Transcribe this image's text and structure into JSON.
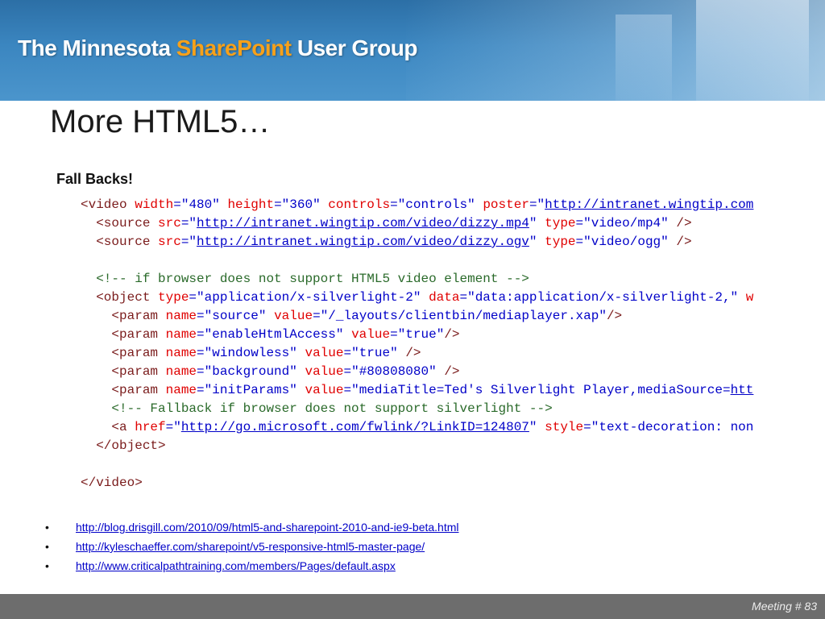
{
  "banner": {
    "title_prefix": "The Minnesota ",
    "title_brand": "SharePoint",
    "title_suffix": " User Group",
    "brand_color": "#f7a11a"
  },
  "slide": {
    "title": "More HTML5…",
    "subhead": "Fall Backs!"
  },
  "code_lines": [
    [
      [
        "t",
        "<video "
      ],
      [
        "a",
        "width"
      ],
      [
        "p",
        "="
      ],
      [
        "v",
        "\"480\" "
      ],
      [
        "a",
        "height"
      ],
      [
        "p",
        "="
      ],
      [
        "v",
        "\"360\" "
      ],
      [
        "a",
        "controls"
      ],
      [
        "p",
        "="
      ],
      [
        "v",
        "\"controls\" "
      ],
      [
        "a",
        "poster"
      ],
      [
        "p",
        "=\""
      ],
      [
        "u",
        "http://intranet.wingtip.com"
      ]
    ],
    [
      [
        "t",
        "  <source "
      ],
      [
        "a",
        "src"
      ],
      [
        "p",
        "=\""
      ],
      [
        "u",
        "http://intranet.wingtip.com/video/dizzy.mp4"
      ],
      [
        "p",
        "\" "
      ],
      [
        "a",
        "type"
      ],
      [
        "p",
        "="
      ],
      [
        "v",
        "\"video/mp4\" "
      ],
      [
        "t",
        "/>"
      ]
    ],
    [
      [
        "t",
        "  <source "
      ],
      [
        "a",
        "src"
      ],
      [
        "p",
        "=\""
      ],
      [
        "u",
        "http://intranet.wingtip.com/video/dizzy.ogv"
      ],
      [
        "p",
        "\" "
      ],
      [
        "a",
        "type"
      ],
      [
        "p",
        "="
      ],
      [
        "v",
        "\"video/ogg\" "
      ],
      [
        "t",
        "/>"
      ]
    ],
    [],
    [
      [
        "c",
        "  <!-- if browser does not support HTML5 video element -->"
      ]
    ],
    [
      [
        "t",
        "  <object "
      ],
      [
        "a",
        "type"
      ],
      [
        "p",
        "="
      ],
      [
        "v",
        "\"application/x-silverlight-2\" "
      ],
      [
        "a",
        "data"
      ],
      [
        "p",
        "="
      ],
      [
        "v",
        "\"data:application/x-silverlight-2,\" "
      ],
      [
        "a",
        "w"
      ]
    ],
    [
      [
        "t",
        "    <param "
      ],
      [
        "a",
        "name"
      ],
      [
        "p",
        "="
      ],
      [
        "v",
        "\"source\" "
      ],
      [
        "a",
        "value"
      ],
      [
        "p",
        "="
      ],
      [
        "v",
        "\"/_layouts/clientbin/mediaplayer.xap\""
      ],
      [
        "t",
        "/>"
      ]
    ],
    [
      [
        "t",
        "    <param "
      ],
      [
        "a",
        "name"
      ],
      [
        "p",
        "="
      ],
      [
        "v",
        "\"enableHtmlAccess\" "
      ],
      [
        "a",
        "value"
      ],
      [
        "p",
        "="
      ],
      [
        "v",
        "\"true\""
      ],
      [
        "t",
        "/>"
      ]
    ],
    [
      [
        "t",
        "    <param "
      ],
      [
        "a",
        "name"
      ],
      [
        "p",
        "="
      ],
      [
        "v",
        "\"windowless\" "
      ],
      [
        "a",
        "value"
      ],
      [
        "p",
        "="
      ],
      [
        "v",
        "\"true\" "
      ],
      [
        "t",
        "/>"
      ]
    ],
    [
      [
        "t",
        "    <param "
      ],
      [
        "a",
        "name"
      ],
      [
        "p",
        "="
      ],
      [
        "v",
        "\"background\" "
      ],
      [
        "a",
        "value"
      ],
      [
        "p",
        "="
      ],
      [
        "v",
        "\"#80808080\" "
      ],
      [
        "t",
        "/>"
      ]
    ],
    [
      [
        "t",
        "    <param "
      ],
      [
        "a",
        "name"
      ],
      [
        "p",
        "="
      ],
      [
        "v",
        "\"initParams\" "
      ],
      [
        "a",
        "value"
      ],
      [
        "p",
        "="
      ],
      [
        "v",
        "\"mediaTitle=Ted's Silverlight Player,mediaSource="
      ],
      [
        "u",
        "htt"
      ]
    ],
    [
      [
        "c",
        "    <!-- Fallback if browser does not support silverlight -->"
      ]
    ],
    [
      [
        "t",
        "    <a "
      ],
      [
        "a",
        "href"
      ],
      [
        "p",
        "=\""
      ],
      [
        "u",
        "http://go.microsoft.com/fwlink/?LinkID=124807"
      ],
      [
        "p",
        "\" "
      ],
      [
        "a",
        "style"
      ],
      [
        "p",
        "="
      ],
      [
        "v",
        "\"text-decoration: non"
      ]
    ],
    [
      [
        "t",
        "  </object>"
      ]
    ],
    [],
    [
      [
        "t",
        "</video>"
      ]
    ]
  ],
  "links": [
    {
      "bullet": "•",
      "text": "http://blog.drisgill.com/2010/09/html5-and-sharepoint-2010-and-ie9-beta.html"
    },
    {
      "bullet": "•",
      "text": "http://kyleschaeffer.com/sharepoint/v5-responsive-html5-master-page/"
    },
    {
      "bullet": "•",
      "text": "http://www.criticalpathtraining.com/members/Pages/default.aspx"
    }
  ],
  "footer": {
    "meeting": "Meeting # 83"
  }
}
